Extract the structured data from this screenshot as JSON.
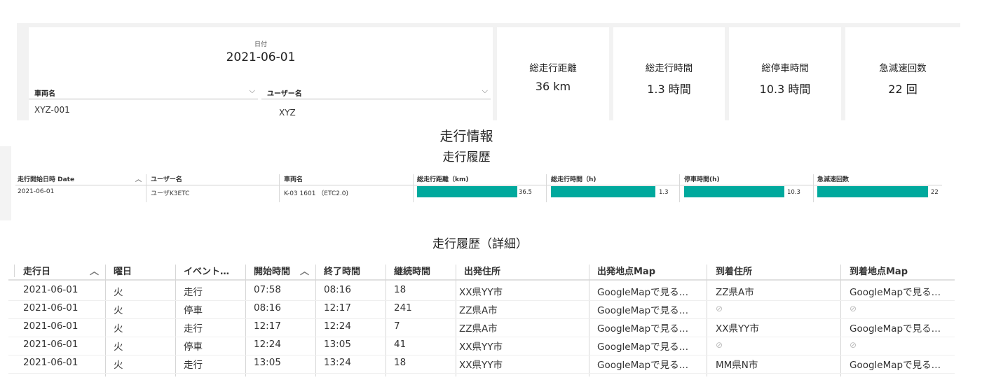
{
  "filters": {
    "date_label": "日付",
    "date_value": "2021-06-01",
    "vehicle_label": "車両名",
    "vehicle_value": "XYZ-001",
    "user_label": "ユーザー名",
    "user_value": "XYZ"
  },
  "kpis": [
    {
      "title": "総走行距離",
      "value": "36 km"
    },
    {
      "title": "総走行時間",
      "value": "1.3 時間"
    },
    {
      "title": "総停車時間",
      "value": "10.3 時間"
    },
    {
      "title": "急減速回数",
      "value": "22 回"
    }
  ],
  "section_title": "走行情報",
  "history": {
    "title": "走行履歴",
    "columns": [
      "走行開始日時 Date",
      "ユーザー名",
      "車両名",
      "総走行距離（km)",
      "総走行時間（h)",
      "停車時間(h)",
      "急減速回数"
    ],
    "row": {
      "date": "2021-06-01",
      "user": "ユーザK3ETC",
      "vehicle": "K-03 1601 （ETC2.0)",
      "distance": "36.5",
      "drive_time": "1.3",
      "stop_time": "10.3",
      "decel": "22"
    },
    "bar_fill": {
      "distance": 0.92,
      "drive_time": 0.92,
      "stop_time": 0.86,
      "decel": 0.92
    },
    "bar_color": "#00a99d"
  },
  "detail": {
    "title": "走行履歴（詳細）",
    "columns": [
      "走行日",
      "曜日",
      "イベント…",
      "開始時間",
      "終了時間",
      "継続時間",
      "出発住所",
      "出発地点Map",
      "到着住所",
      "到着地点Map"
    ],
    "rows": [
      [
        "2021-06-01",
        "火",
        "走行",
        "07:58",
        "08:16",
        "18",
        "XX県YY市",
        "GoogleMapで見る…",
        "ZZ県A市",
        "GoogleMapで見る…"
      ],
      [
        "2021-06-01",
        "火",
        "停車",
        "08:16",
        "12:17",
        "241",
        "ZZ県A市",
        "GoogleMapで見る…",
        "⊘",
        "⊘"
      ],
      [
        "2021-06-01",
        "火",
        "走行",
        "12:17",
        "12:24",
        "7",
        "ZZ県A市",
        "GoogleMapで見る…",
        "XX県YY市",
        "GoogleMapで見る…"
      ],
      [
        "2021-06-01",
        "火",
        "停車",
        "12:24",
        "13:05",
        "41",
        "XX県YY市",
        "GoogleMapで見る…",
        "⊘",
        "⊘"
      ],
      [
        "2021-06-01",
        "火",
        "走行",
        "13:05",
        "13:24",
        "18",
        "XX県YY市",
        "GoogleMapで見る…",
        "MM県N市",
        "GoogleMapで見る…"
      ]
    ]
  }
}
